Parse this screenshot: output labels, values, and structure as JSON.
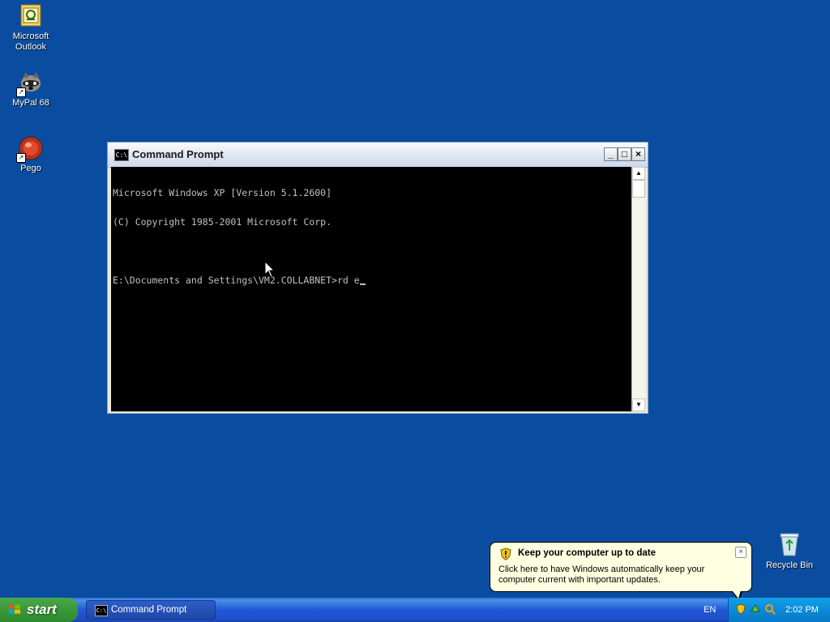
{
  "desktop": {
    "icons": [
      {
        "label": "Microsoft Outlook"
      },
      {
        "label": "MyPal 68"
      },
      {
        "label": "Pego"
      }
    ],
    "recycle_bin": "Recycle Bin"
  },
  "window": {
    "title": "Command Prompt",
    "console_lines": [
      "Microsoft Windows XP [Version 5.1.2600]",
      "(C) Copyright 1985-2001 Microsoft Corp.",
      "",
      "E:\\Documents and Settings\\VM2.COLLABNET>rd e"
    ]
  },
  "balloon": {
    "title": "Keep your computer up to date",
    "text": "Click here to have Windows automatically keep your computer current with important updates."
  },
  "taskbar": {
    "start_label": "start",
    "task_label": "Command Prompt",
    "language": "EN",
    "clock": "2:02 PM"
  },
  "colors": {
    "desktop": "#0a4da0",
    "console_bg": "#000000",
    "console_text": "#c0c0c0",
    "balloon_bg": "#ffffe1"
  }
}
